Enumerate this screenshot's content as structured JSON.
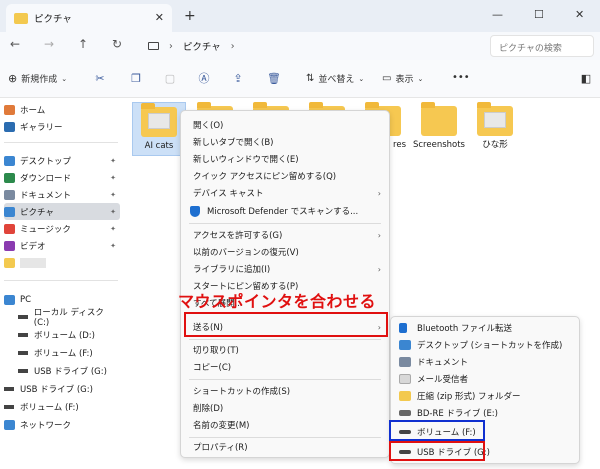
{
  "window": {
    "tab_title": "ピクチャ",
    "tab_close": "✕",
    "new_tab": "+",
    "minimize": "—",
    "maximize": "☐",
    "close": "✕"
  },
  "nav": {
    "back": "←",
    "forward": "→",
    "up": "↑",
    "refresh": "↻",
    "breadcrumb_sep": "›",
    "breadcrumb": "ピクチャ",
    "breadcrumb_chevron": "›",
    "search_placeholder": "ピクチャの検索"
  },
  "toolbar": {
    "new_label": "新規作成",
    "sort_label": "並べ替え",
    "view_label": "表示",
    "more": "•••"
  },
  "sidebar": {
    "items": [
      {
        "label": "ホーム",
        "icon_color": "#e07a3a"
      },
      {
        "label": "ギャラリー",
        "icon_color": "#2b6cb0"
      },
      {
        "label": "デスクトップ",
        "icon_color": "#3b86d1"
      },
      {
        "label": "ダウンロード",
        "icon_color": "#2c8a4c"
      },
      {
        "label": "ドキュメント",
        "icon_color": "#7a8aa0"
      },
      {
        "label": "ピクチャ",
        "icon_color": "#3b86d1"
      },
      {
        "label": "ミュージック",
        "icon_color": "#e0443a"
      },
      {
        "label": "ビデオ",
        "icon_color": "#8a3bb0"
      }
    ],
    "pin": "📌",
    "pc": {
      "label": "PC",
      "drives": [
        "ローカル ディスク (C:)",
        "ボリューム (D:)",
        "ボリューム (F:)",
        "USB ドライブ (G:)"
      ]
    },
    "usb": "USB ドライブ (G:)",
    "volume": "ボリューム (F:)",
    "network": "ネットワーク"
  },
  "files": [
    {
      "name": "AI cats"
    },
    {
      "name": "res"
    },
    {
      "name": "Screenshots"
    },
    {
      "name": "ひな形"
    }
  ],
  "context_menu": {
    "items": [
      "開く(O)",
      "新しいタブで開く(B)",
      "新しいウィンドウで開く(E)",
      "クイック アクセスにピン留めする(Q)",
      "デバイス キャスト",
      "Microsoft Defender でスキャンする...",
      "アクセスを許可する(G)",
      "以前のバージョンの復元(V)",
      "ライブラリに追加(I)",
      "スタートにピン留めする(P)",
      "すべて展開...",
      "送る(N)",
      "切り取り(T)",
      "コピー(C)",
      "ショートカットの作成(S)",
      "削除(D)",
      "名前の変更(M)",
      "プロパティ(R)"
    ],
    "arrow": "›"
  },
  "send_to_menu": {
    "items": [
      {
        "label": "Bluetooth ファイル転送",
        "icon_color": "#1e6fd0"
      },
      {
        "label": "デスクトップ (ショートカットを作成)",
        "icon_color": "#3b86d1"
      },
      {
        "label": "ドキュメント",
        "icon_color": "#7a8aa0"
      },
      {
        "label": "メール受信者",
        "icon_color": "#d8d8d8"
      },
      {
        "label": "圧縮 (zip 形式) フォルダー",
        "icon_color": "#f3c94f"
      },
      {
        "label": "BD-RE ドライブ (E:)",
        "icon_color": "#666666"
      },
      {
        "label": "ボリューム (F:)",
        "icon_color": "#444444"
      },
      {
        "label": "USB ドライブ (G:)",
        "icon_color": "#444444"
      }
    ]
  },
  "annotation": {
    "callout": "マウスポインタを合わせる",
    "red": "#e01010",
    "blue": "#1030d0"
  }
}
